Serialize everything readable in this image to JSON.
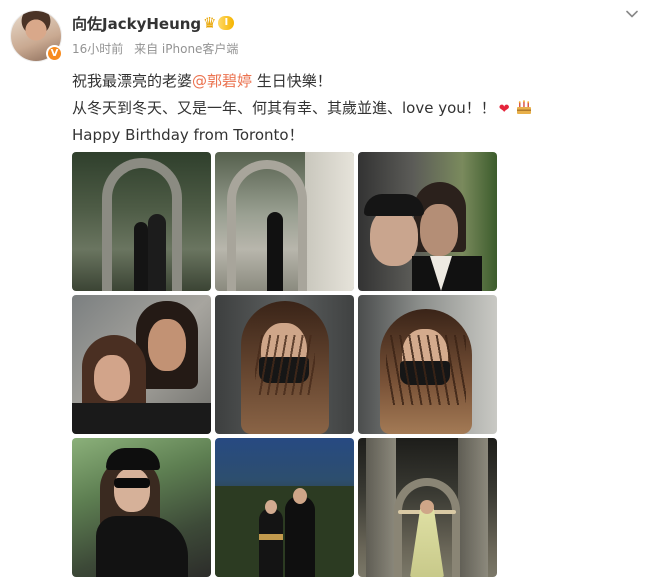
{
  "post": {
    "author": {
      "name": "向佐JackyHeung",
      "verified_badge": "V",
      "level_badge": "I",
      "crown_icon": "crown-icon"
    },
    "meta": {
      "time": "16小时前",
      "source": "来自 iPhone客户端"
    },
    "content": {
      "line1_prefix": "祝我最漂亮的老婆",
      "mention": "@郭碧婷",
      "line1_suffix": " 生日快樂！",
      "line2": "从冬天到冬天、又是一年、何其有幸、其歲並進、love you！！",
      "line3": "Happy Birthday from Toronto！"
    },
    "emojis": [
      "heart-icon",
      "cake-icon"
    ],
    "photos_count": 9,
    "colors": {
      "mention": "#eb7350",
      "meta_text": "#939393",
      "text": "#333333",
      "verified": "#f78b1f"
    }
  }
}
